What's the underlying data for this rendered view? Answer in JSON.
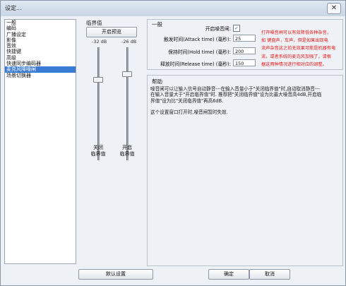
{
  "window": {
    "title": "设定...",
    "close_glyph": "✕"
  },
  "sidebar": {
    "items": [
      {
        "label": "一般",
        "selected": false
      },
      {
        "label": "编码",
        "selected": false
      },
      {
        "label": "广播设定",
        "selected": false
      },
      {
        "label": "影像",
        "selected": false
      },
      {
        "label": "音效",
        "selected": false
      },
      {
        "label": "快捷键",
        "selected": false
      },
      {
        "label": "高级",
        "selected": false
      },
      {
        "label": "快速同步编码器",
        "selected": false
      },
      {
        "label": "麦克风降噪闸",
        "selected": true
      },
      {
        "label": "场景切换器",
        "selected": false
      }
    ]
  },
  "threshold": {
    "label": "临界值",
    "preview_button": "开启预览",
    "close_db": "-32 dB",
    "open_db": "-26 dB",
    "close_caption_1": "关闭",
    "close_caption_2": "临界值",
    "open_caption_1": "开启",
    "open_caption_2": "临界值"
  },
  "general": {
    "label": "一般",
    "enable_label": "开启噪音闸:",
    "enable_checked_glyph": "✓",
    "attack_label": "触发时间(Attack time) (毫秒):",
    "attack_value": "25",
    "hold_label": "保持时间(Hold time) (毫秒):",
    "hold_value": "200",
    "release_label": "释放时间(Release time) (毫秒):",
    "release_value": "150",
    "red_note_1": "打开噪音闸可以有效降低各种杂音，",
    "red_note_2": "如 键盘声，车声，但是如果出现电",
    "red_note_3": "流声杂音这之前无效果可能是机器有电",
    "red_note_4": "流，或者系统的麦克风加强了，请根",
    "red_note_5": "据这两种情况进行相对应的调整。"
  },
  "help": {
    "label": "帮助",
    "para1_line1": "噪音闸可以让输入信号自动静音---在输入音量小于\"关闭临界值\"时,自动取消静音---",
    "para1_line2": "在输入音量大于\"开启临界值\"时. 推荐把\"关闭临界值\"设为比最大噪音高4dB,开启临",
    "para1_line3": "界值\"设为比\"关闭临界值\"再高6dB.",
    "para2": "这个设置窗口打开时,噪音闸暂时失效."
  },
  "bottom": {
    "defaults": "默认设置",
    "ok": "确定",
    "cancel": "取消"
  }
}
